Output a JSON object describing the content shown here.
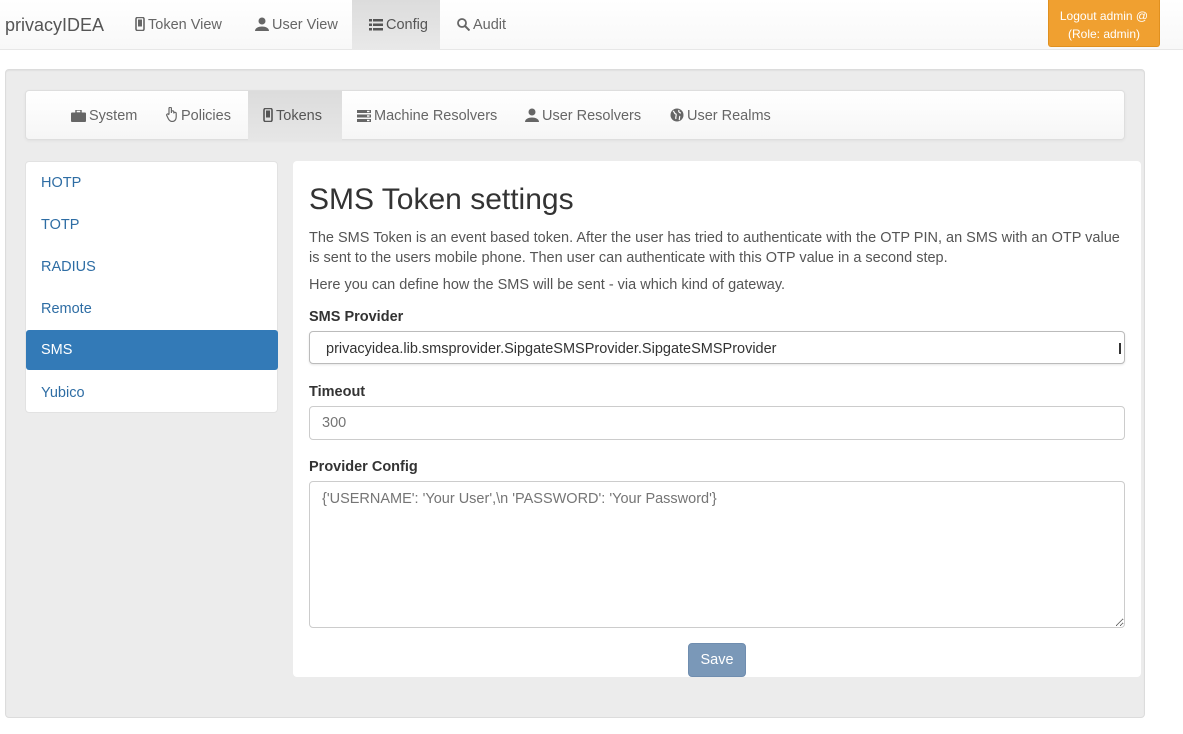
{
  "navbar": {
    "brand": "privacyIDEA",
    "items": [
      {
        "label": "Token View",
        "icon": "mobile-icon"
      },
      {
        "label": "User View",
        "icon": "user-icon"
      },
      {
        "label": "Config",
        "icon": "list-icon",
        "active": true
      },
      {
        "label": "Audit",
        "icon": "search-icon"
      }
    ],
    "logout_line1": "Logout admin @",
    "logout_line2": "(Role: admin)"
  },
  "subnav": {
    "items": [
      {
        "label": "System",
        "icon": "briefcase-icon"
      },
      {
        "label": "Policies",
        "icon": "hand-pointer-icon"
      },
      {
        "label": "Tokens",
        "icon": "mobile-icon",
        "active": true
      },
      {
        "label": "Machine Resolvers",
        "icon": "tasks-icon"
      },
      {
        "label": "User Resolvers",
        "icon": "user-icon"
      },
      {
        "label": "User Realms",
        "icon": "globe-icon"
      }
    ]
  },
  "token_types": [
    "HOTP",
    "TOTP",
    "RADIUS",
    "Remote",
    "SMS",
    "Yubico"
  ],
  "selected_token_type": "SMS",
  "form": {
    "title": "SMS Token settings",
    "description": "The SMS Token is an event based token. After the user has tried to authenticate with the OTP PIN, an SMS with an OTP value is sent to the users mobile phone. Then user can authenticate with this OTP value in a second step.",
    "description2": "Here you can define how the SMS will be sent - via which kind of gateway.",
    "provider_label": "SMS Provider",
    "provider_value": "privacyidea.lib.smsprovider.SipgateSMSProvider.SipgateSMSProvider",
    "timeout_label": "Timeout",
    "timeout_placeholder": "300",
    "config_label": "Provider Config",
    "config_placeholder": "{'USERNAME': 'Your User',\\n 'PASSWORD': 'Your Password'}",
    "save_label": "Save"
  },
  "colors": {
    "accent": "#337ab7",
    "logout": "#f0a030",
    "save": "#7a98b8"
  }
}
